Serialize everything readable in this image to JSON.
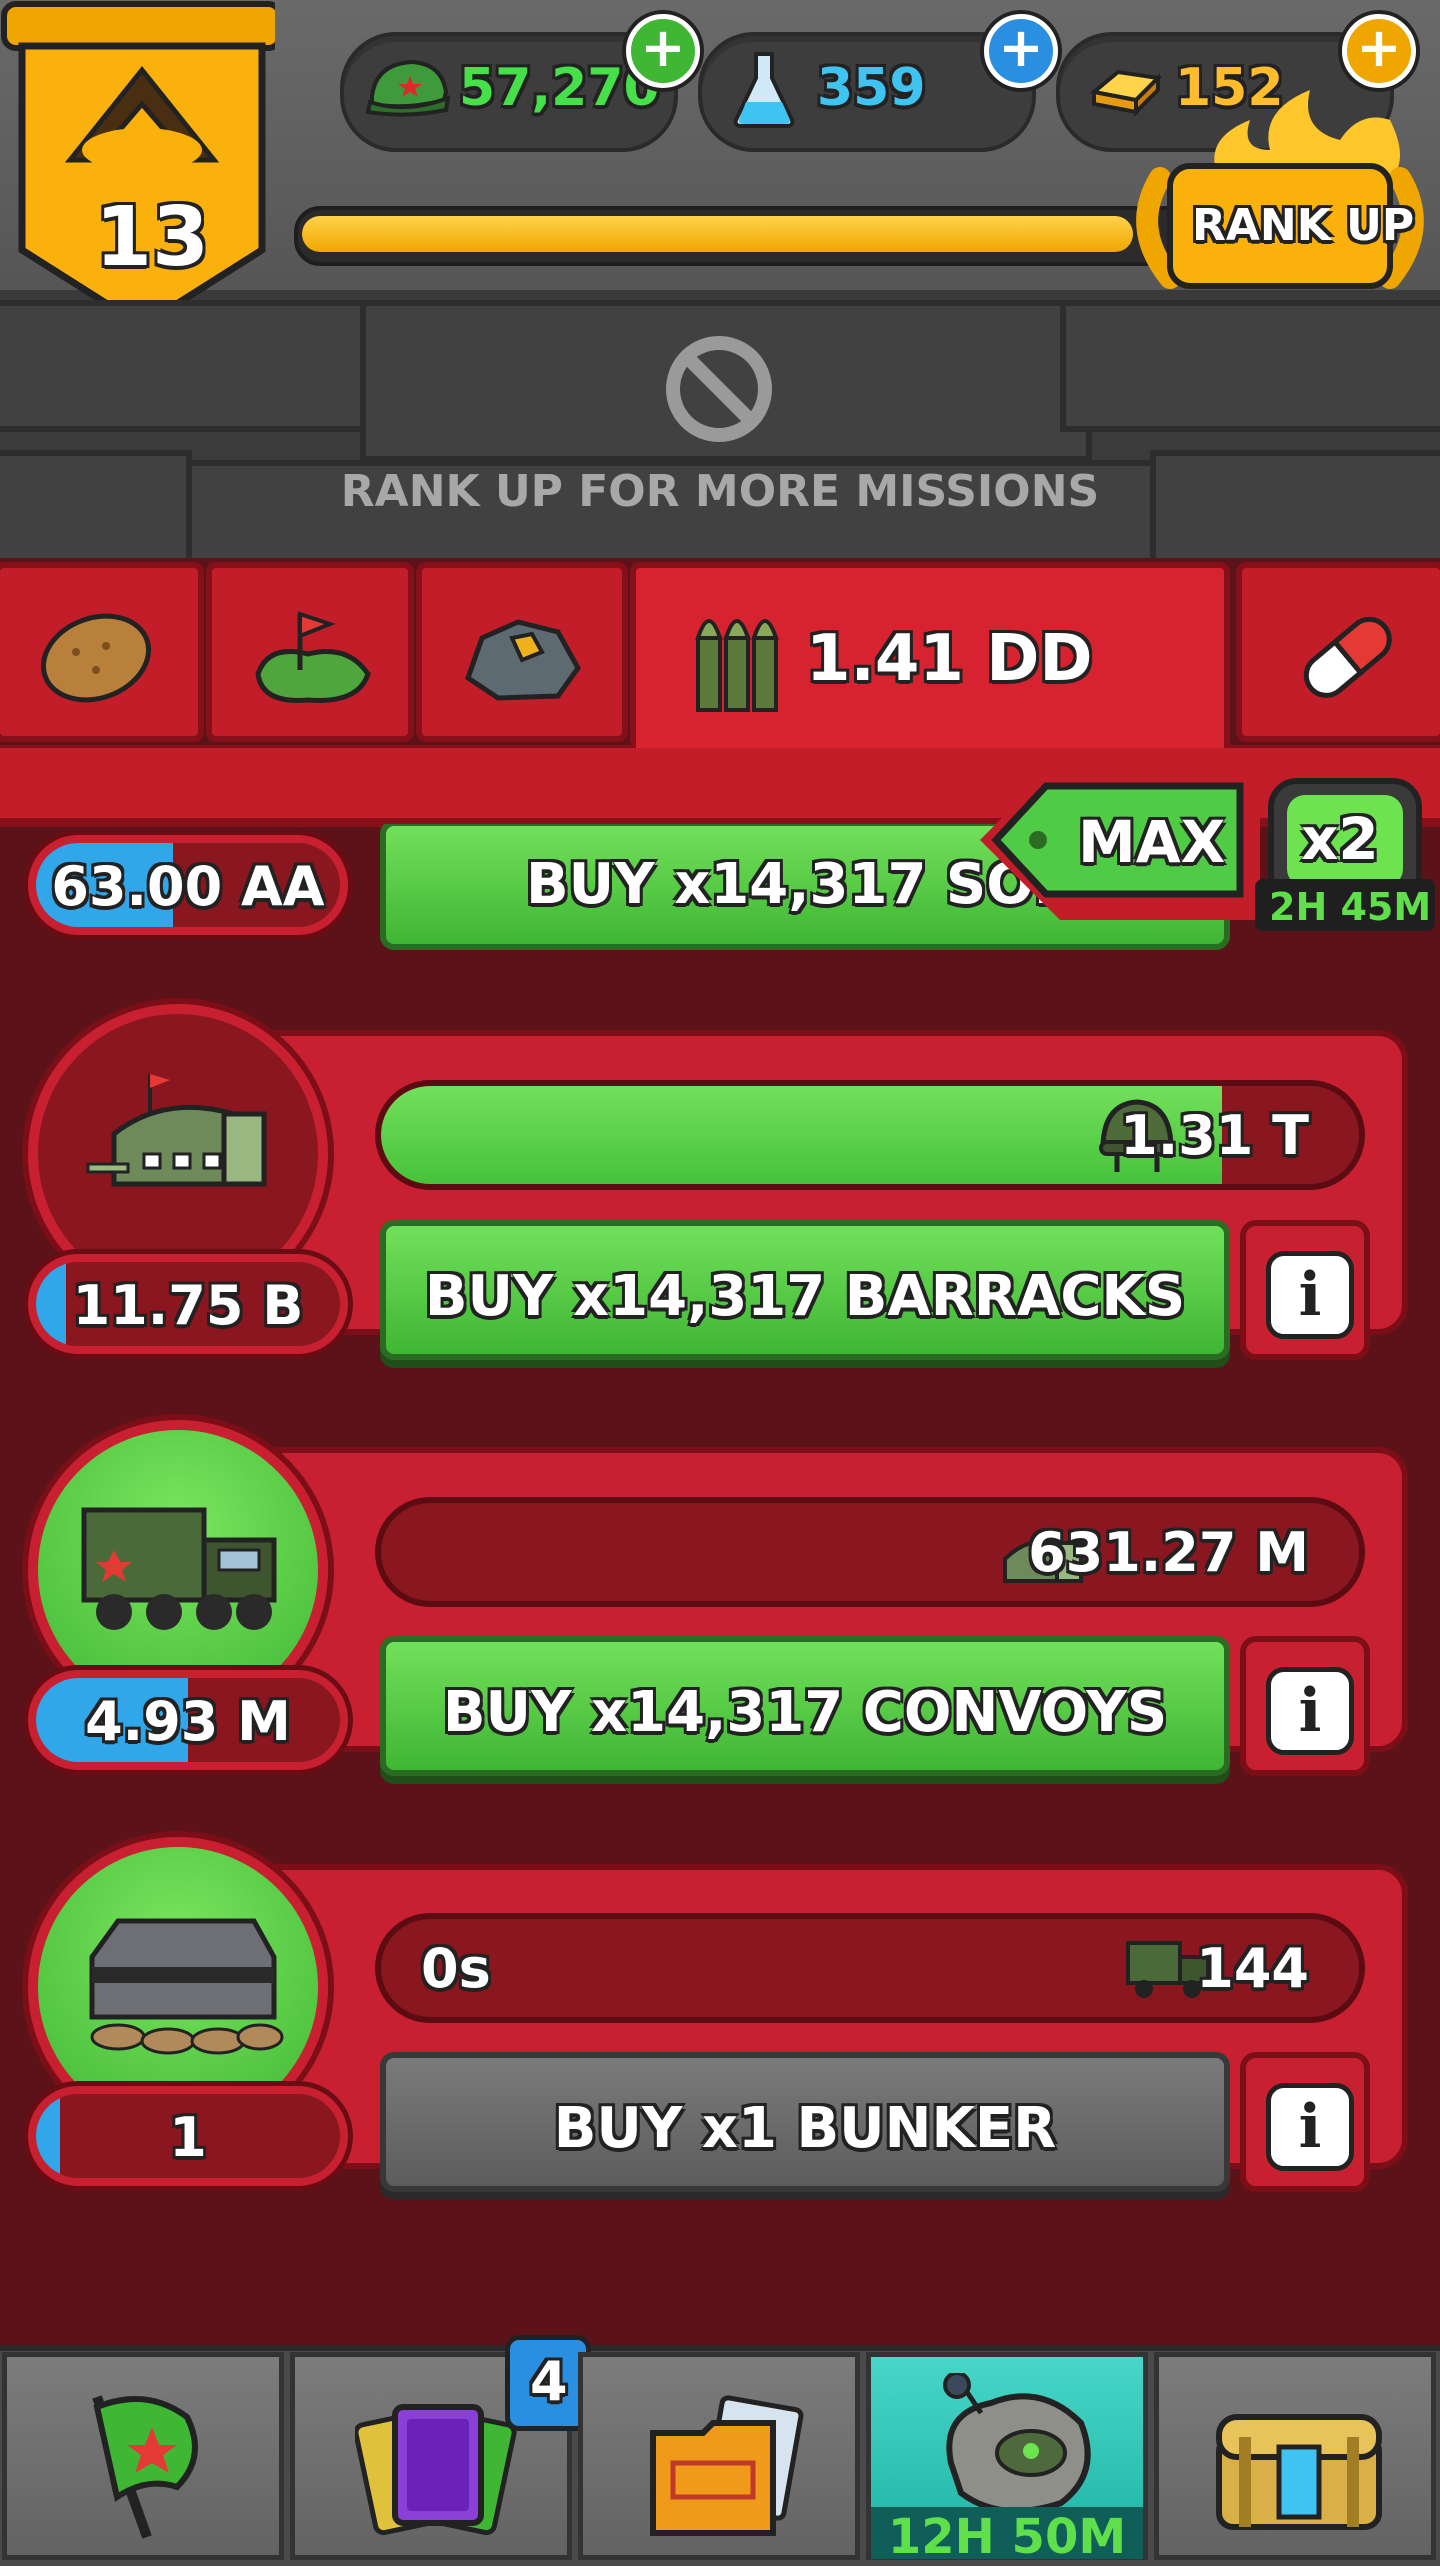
{
  "header": {
    "rank_level": "13",
    "currencies": [
      {
        "name": "soldier-cap",
        "value": "57,270",
        "color": "#45e04a"
      },
      {
        "name": "science-flask",
        "value": "359",
        "color": "#3fc4f2"
      },
      {
        "name": "gold-bars",
        "value": "152",
        "color": "#ffbd2e"
      }
    ],
    "xp_progress": 0.94,
    "rank_up_label": "RANK UP"
  },
  "missions": {
    "locked_label": "RANK UP FOR MORE MISSIONS"
  },
  "tabs": {
    "items": [
      "potato",
      "flag-map",
      "rock",
      "bullets",
      "pill"
    ],
    "active_value": "1.41 DD"
  },
  "controls": {
    "max_label": "MAX",
    "boost_label": "x2",
    "boost_timer": "2H 45M"
  },
  "units": [
    {
      "name": "soldiers",
      "owned": "63.00 AA",
      "owned_fill": 0.45,
      "buy_label": "BUY x14,317 SOLD…"
    },
    {
      "name": "barracks",
      "owned": "11.75 B",
      "owned_fill": 0.1,
      "progress": 0.86,
      "produces": "1.31 T",
      "buy_label": "BUY x14,317 BARRACKS",
      "buy_enabled": true
    },
    {
      "name": "convoys",
      "owned": "4.93 M",
      "owned_fill": 0.5,
      "progress": 0.0,
      "produces": "631.27 M",
      "buy_label": "BUY x14,317 CONVOYS",
      "buy_enabled": true
    },
    {
      "name": "bunker",
      "owned": "1",
      "owned_fill": 0.08,
      "progress": 0.0,
      "timer": "0s",
      "produces": "144",
      "buy_label": "BUY x1 BUNKER",
      "buy_enabled": false
    }
  ],
  "bottom_nav": {
    "items": [
      "flag",
      "cards",
      "folder",
      "asteroid-base",
      "treasure-chest"
    ],
    "cards_badge": "4",
    "active_timer": "12H 50M"
  }
}
